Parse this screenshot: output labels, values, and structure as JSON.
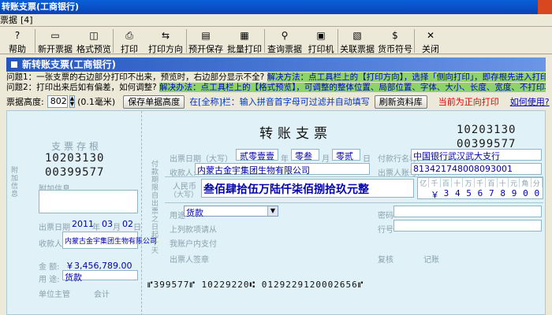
{
  "window": {
    "title": "转账支票(工商银行)"
  },
  "menubar": {
    "item": "票据",
    "accel": "[4]"
  },
  "toolbar": {
    "buttons": [
      {
        "label": "帮助",
        "icon": "?"
      },
      {
        "label": "新开票据",
        "icon": "▭"
      },
      {
        "label": "格式预览",
        "icon": "◫"
      },
      {
        "label": "打印",
        "icon": "⎙"
      },
      {
        "label": "打印方向",
        "icon": "⇆"
      },
      {
        "label": "预开保存",
        "icon": "▤"
      },
      {
        "label": "批量打印",
        "icon": "▦"
      },
      {
        "label": "查询票据",
        "icon": "⚲"
      },
      {
        "label": "打印机",
        "icon": "▣"
      },
      {
        "label": "关联票据",
        "icon": "▧"
      },
      {
        "label": "货币符号",
        "icon": "$"
      },
      {
        "label": "关闭",
        "icon": "✕"
      }
    ]
  },
  "panel": {
    "title": "新转账支票(工商银行)"
  },
  "tips": {
    "q1": "问题1：一张支票的右边部分打印不出来，预览时，右边部分显示不全?",
    "a1": "解决方法：点工具栏上的【打印方向】，选择「侧向打印」，即存根先进入打印机。",
    "q2": "问题2：打印出来后如有偏差，如何调整?",
    "a2": "解决办法：点工具栏上的【格式预览】，可调整的整体位置、局部位置、字体、大小、长度、宽度、不打印项。"
  },
  "controls": {
    "height_label": "票据高度:",
    "height_value": "802",
    "height_unit": "(0.1毫米)",
    "save_height_button": "保存单据高度",
    "hint": "在[全称]栏：输入拼音首字母可过滤并自动填写",
    "refresh_button": "刷新资料库",
    "direction_notice": "当前为正向打印",
    "howto_link": "如何使用?"
  },
  "stub": {
    "title": "支票存根",
    "number_top": "10203130",
    "number_bottom": "00399577",
    "vertical_text": "附加信息",
    "extra_label": "附加信息",
    "date_label_prefix": "出票日期",
    "year": "2011",
    "year_unit": "年",
    "month": "03",
    "month_unit": "月",
    "day": "02",
    "day_unit": "日",
    "payee_label": "收款人:",
    "payee_value": "内蒙古金宇集团生物有限公司",
    "amount_label": "金 额:",
    "amount_value": "￥3,456,789.00",
    "use_label": "用 途:",
    "use_value": "货款",
    "unit_manager": "单位主管",
    "accountant": "会计"
  },
  "cheque": {
    "title": "转账支票",
    "number_top": "10203130",
    "number_bottom": "00399577",
    "date_label": "出票日期（大写）",
    "year_upper": "贰零壹壹",
    "year_unit": "年",
    "month_upper": "零叁",
    "month_unit": "月",
    "day_upper": "零贰",
    "day_unit": "日",
    "payee_label": "收款人:",
    "payee_value": "内蒙古金宇集团生物有限公司",
    "bank_label": "付款行名称:",
    "bank_value": "中国银行武汉武大支行",
    "account_label": "出票人账号:",
    "account_value": "813421748008093001",
    "rmb_label": "人民币",
    "rmb_sub": "（大写）",
    "rmb_value": "叁佰肆拾伍万陆仟柒佰捌拾玖元整",
    "amount_units": [
      "亿",
      "千",
      "百",
      "十",
      "万",
      "千",
      "百",
      "十",
      "元",
      "角",
      "分"
    ],
    "amount_digits": [
      "",
      "",
      "￥",
      "3",
      "4",
      "5",
      "6",
      "7",
      "8",
      "9",
      "0",
      "0"
    ],
    "use_label": "用途",
    "use_value": "货款",
    "password_label": "密码",
    "line_label": "行号",
    "side_text": "付款期限自出票之日起十天",
    "note1": "上列款项请从",
    "note2": "我账户内支付",
    "drawer_sign": "出票人签章",
    "review": "复核",
    "bookkeeping": "记账",
    "micr_line": "⑈399577⑈ 10229220⑆ 0129229120002656⑈"
  }
}
